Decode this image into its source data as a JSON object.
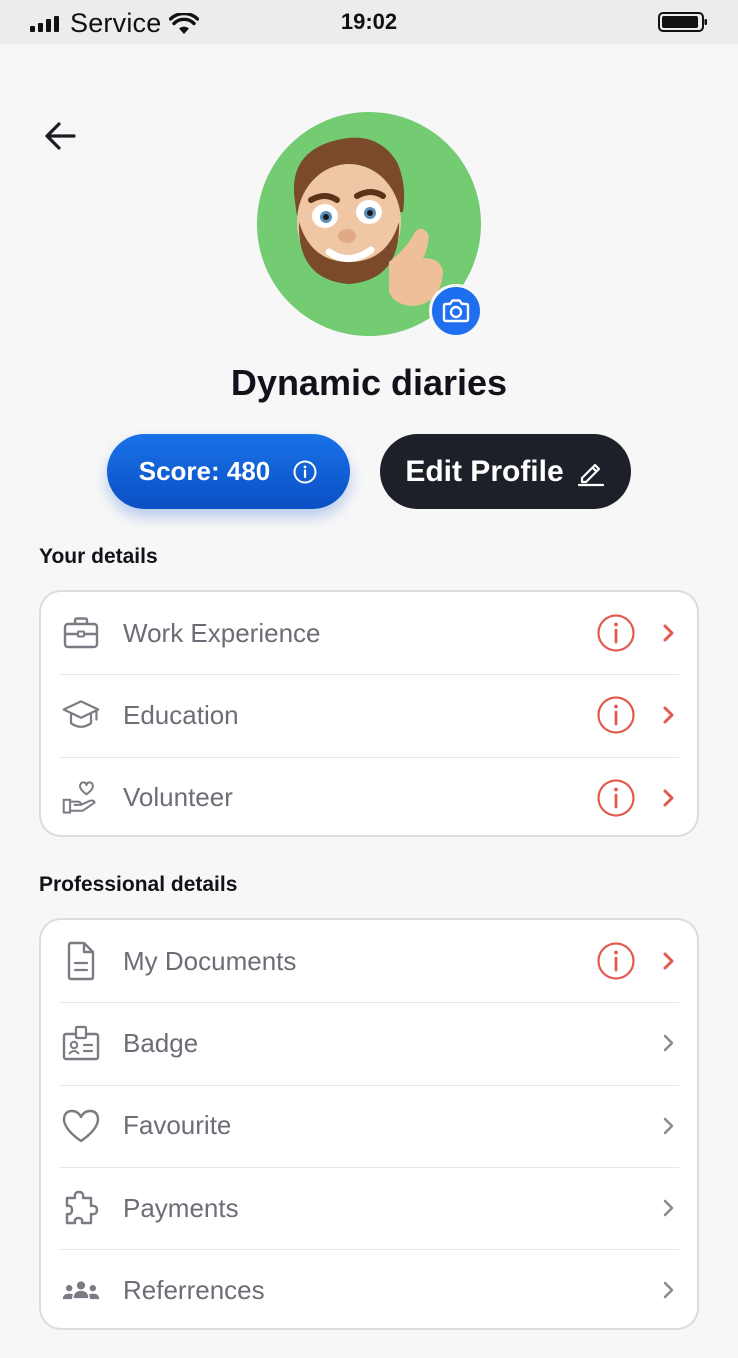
{
  "status_bar": {
    "carrier": "Service",
    "time": "19:02"
  },
  "profile": {
    "name": "Dynamic diaries",
    "score_label": "Score: 480",
    "edit_label": "Edit Profile"
  },
  "sections": {
    "your_details": {
      "title": "Your details",
      "items": [
        {
          "label": "Work Experience",
          "icon": "briefcase-icon",
          "warning": true
        },
        {
          "label": "Education",
          "icon": "graduation-cap-icon",
          "warning": true
        },
        {
          "label": "Volunteer",
          "icon": "hand-heart-icon",
          "warning": true
        }
      ]
    },
    "professional_details": {
      "title": "Professional details",
      "items": [
        {
          "label": "My Documents",
          "icon": "document-icon",
          "warning": true
        },
        {
          "label": "Badge",
          "icon": "badge-icon",
          "warning": false
        },
        {
          "label": "Favourite",
          "icon": "heart-icon",
          "warning": false
        },
        {
          "label": "Payments",
          "icon": "puzzle-icon",
          "warning": false
        },
        {
          "label": "Referrences",
          "icon": "people-icon",
          "warning": false
        }
      ]
    }
  },
  "colors": {
    "accent_blue": "#1a72e8",
    "dark_button": "#1d2029",
    "warning_red": "#e05a4e",
    "avatar_bg": "#73cb72"
  }
}
